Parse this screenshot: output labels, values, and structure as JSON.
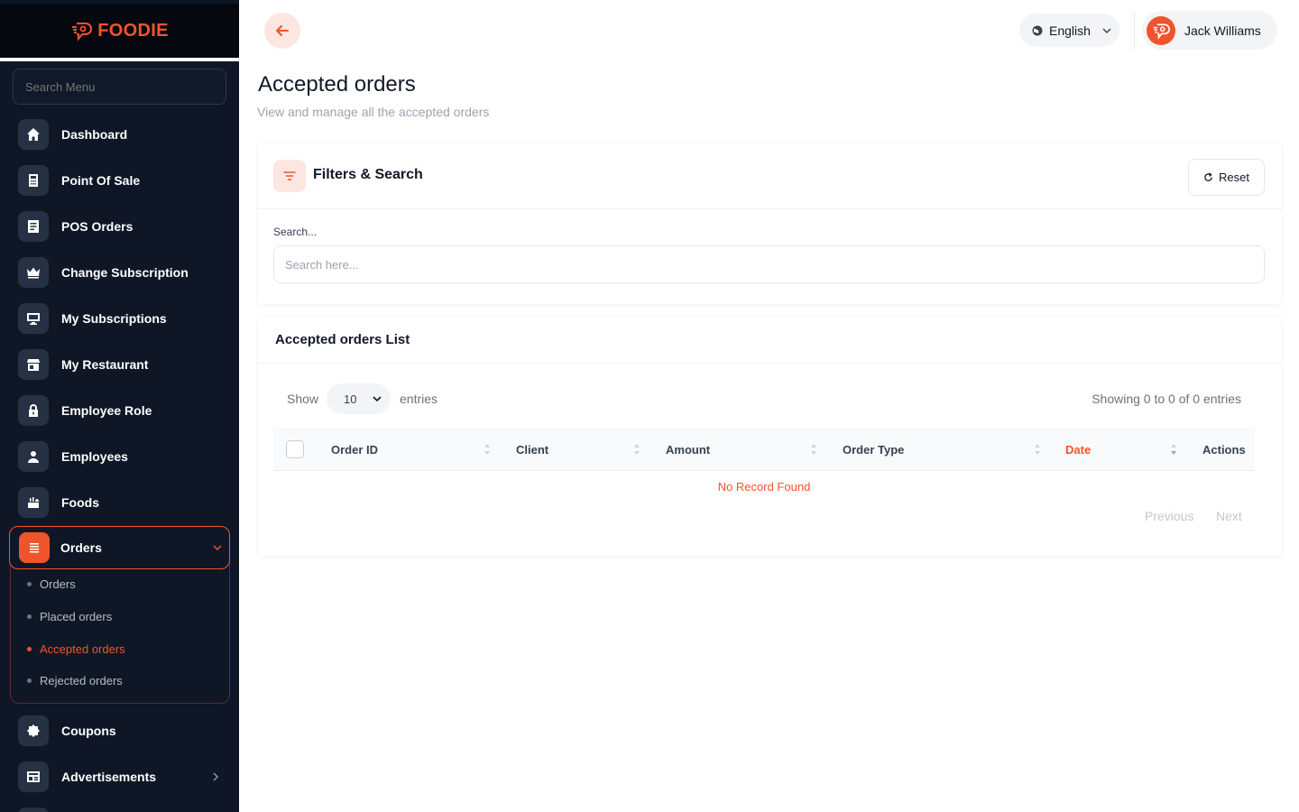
{
  "brand": {
    "name": "FOODIE",
    "color": "#f0542d"
  },
  "sidebar": {
    "search_placeholder": "Search Menu",
    "items": [
      {
        "label": "Dashboard",
        "icon": "home-icon"
      },
      {
        "label": "Point Of Sale",
        "icon": "calculator-icon"
      },
      {
        "label": "POS Orders",
        "icon": "receipt-icon"
      },
      {
        "label": "Change Subscription",
        "icon": "crown-icon"
      },
      {
        "label": "My Subscriptions",
        "icon": "monitor-icon"
      },
      {
        "label": "My Restaurant",
        "icon": "store-icon"
      },
      {
        "label": "Employee Role",
        "icon": "lock-icon"
      },
      {
        "label": "Employees",
        "icon": "user-icon"
      },
      {
        "label": "Foods",
        "icon": "food-icon"
      }
    ],
    "orders": {
      "label": "Orders",
      "sub_items": [
        "Orders",
        "Placed orders",
        "Accepted orders",
        "Rejected orders"
      ],
      "active": "Accepted orders"
    },
    "after_items": [
      {
        "label": "Coupons",
        "icon": "badge-icon"
      },
      {
        "label": "Advertisements",
        "icon": "ad-icon"
      }
    ]
  },
  "topbar": {
    "language": "English",
    "user_name": "Jack Williams"
  },
  "page": {
    "title": "Accepted orders",
    "subtitle": "View and manage all the accepted orders"
  },
  "filters": {
    "title": "Filters & Search",
    "reset_label": "Reset",
    "search_label": "Search...",
    "search_placeholder": "Search here...",
    "search_value": ""
  },
  "list": {
    "title": "Accepted orders List",
    "show_label": "Show",
    "entries_value": "10",
    "entries_label": "entries",
    "showing_text": "Showing 0 to 0 of 0 entries",
    "columns": [
      "Order ID",
      "Client",
      "Amount",
      "Order Type",
      "Date",
      "Actions"
    ],
    "empty_text": "No Record Found",
    "previous_label": "Previous",
    "next_label": "Next"
  }
}
